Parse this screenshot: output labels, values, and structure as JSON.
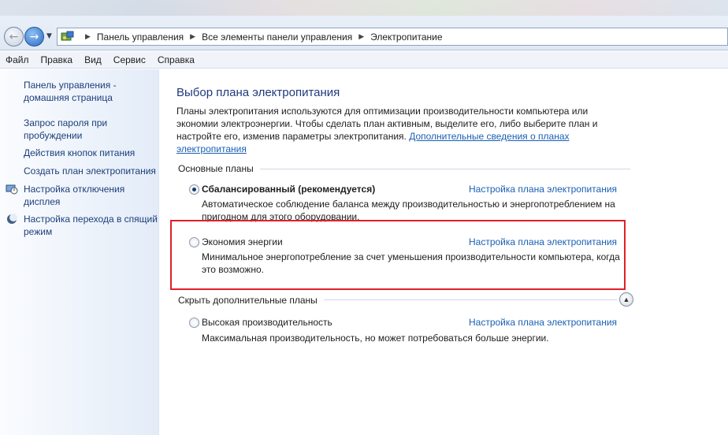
{
  "address": {
    "breadcrumbs": [
      "Панель управления",
      "Все элементы панели управления",
      "Электропитание"
    ]
  },
  "menu": [
    "Файл",
    "Правка",
    "Вид",
    "Сервис",
    "Справка"
  ],
  "sidebar": {
    "items": [
      {
        "label": "Панель управления - домашняя страница",
        "icon": "none"
      },
      {
        "label": "Запрос пароля при пробуждении",
        "icon": "none"
      },
      {
        "label": "Действия кнопок питания",
        "icon": "none"
      },
      {
        "label": "Создать план электропитания",
        "icon": "none"
      },
      {
        "label": "Настройка отключения дисплея",
        "icon": "display-clock-icon"
      },
      {
        "label": "Настройка перехода в спящий режим",
        "icon": "moon-icon"
      }
    ]
  },
  "main": {
    "title": "Выбор плана электропитания",
    "intro": "Планы электропитания используются для оптимизации производительности компьютера или экономии электроэнергии. Чтобы сделать план активным, выделите его, либо выберите план и настройте его, изменив параметры электропитания.",
    "intro_link": "Дополнительные сведения о планах электропитания",
    "basic_group": "Основные планы",
    "hidden_group": "Скрыть дополнительные планы",
    "plans": [
      {
        "name": "Сбалансированный (рекомендуется)",
        "selected": true,
        "link": "Настройка плана электропитания",
        "desc": "Автоматическое соблюдение баланса между производительностью и энергопотреблением на пригодном для этого оборудовании."
      },
      {
        "name": "Экономия энергии",
        "selected": false,
        "link": "Настройка плана электропитания",
        "desc": "Минимальное энергопотребление за счет уменьшения производительности компьютера, когда это возможно."
      },
      {
        "name": "Высокая производительность",
        "selected": false,
        "link": "Настройка плана электропитания",
        "desc": "Максимальная производительность, но может потребоваться больше энергии."
      }
    ]
  },
  "colors": {
    "highlight": "#e0202a",
    "link": "#1a5fb4",
    "title": "#1e3a7b"
  }
}
